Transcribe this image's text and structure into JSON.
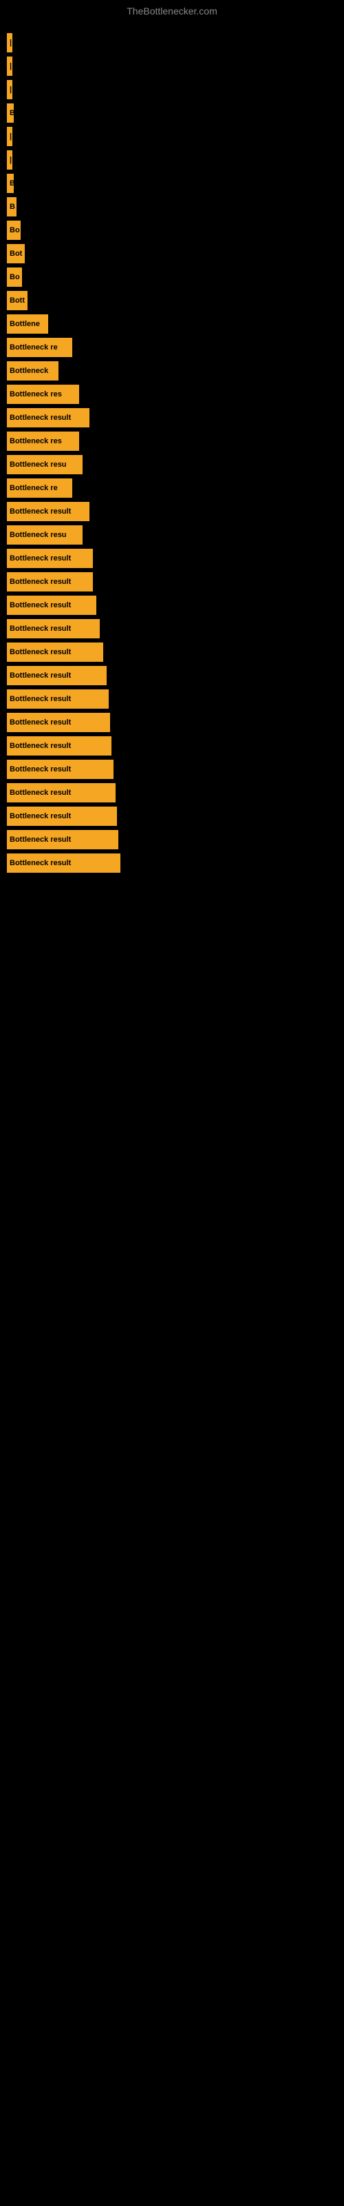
{
  "site_title": "TheBottlenecker.com",
  "items": [
    {
      "label": "|",
      "width": 4
    },
    {
      "label": "|",
      "width": 6
    },
    {
      "label": "|",
      "width": 6
    },
    {
      "label": "B",
      "width": 10
    },
    {
      "label": "|",
      "width": 6
    },
    {
      "label": "|",
      "width": 6
    },
    {
      "label": "B",
      "width": 10
    },
    {
      "label": "B",
      "width": 14
    },
    {
      "label": "Bo",
      "width": 20
    },
    {
      "label": "Bot",
      "width": 26
    },
    {
      "label": "Bo",
      "width": 22
    },
    {
      "label": "Bott",
      "width": 30
    },
    {
      "label": "Bottlene",
      "width": 60
    },
    {
      "label": "Bottleneck re",
      "width": 95
    },
    {
      "label": "Bottleneck",
      "width": 75
    },
    {
      "label": "Bottleneck res",
      "width": 105
    },
    {
      "label": "Bottleneck result",
      "width": 120
    },
    {
      "label": "Bottleneck res",
      "width": 105
    },
    {
      "label": "Bottleneck resu",
      "width": 110
    },
    {
      "label": "Bottleneck re",
      "width": 95
    },
    {
      "label": "Bottleneck result",
      "width": 120
    },
    {
      "label": "Bottleneck resu",
      "width": 110
    },
    {
      "label": "Bottleneck result",
      "width": 125
    },
    {
      "label": "Bottleneck result",
      "width": 125
    },
    {
      "label": "Bottleneck result",
      "width": 130
    },
    {
      "label": "Bottleneck result",
      "width": 135
    },
    {
      "label": "Bottleneck result",
      "width": 140
    },
    {
      "label": "Bottleneck result",
      "width": 145
    },
    {
      "label": "Bottleneck result",
      "width": 148
    },
    {
      "label": "Bottleneck result",
      "width": 150
    },
    {
      "label": "Bottleneck result",
      "width": 152
    },
    {
      "label": "Bottleneck result",
      "width": 155
    },
    {
      "label": "Bottleneck result",
      "width": 158
    },
    {
      "label": "Bottleneck result",
      "width": 160
    },
    {
      "label": "Bottleneck result",
      "width": 162
    },
    {
      "label": "Bottleneck result",
      "width": 165
    }
  ]
}
